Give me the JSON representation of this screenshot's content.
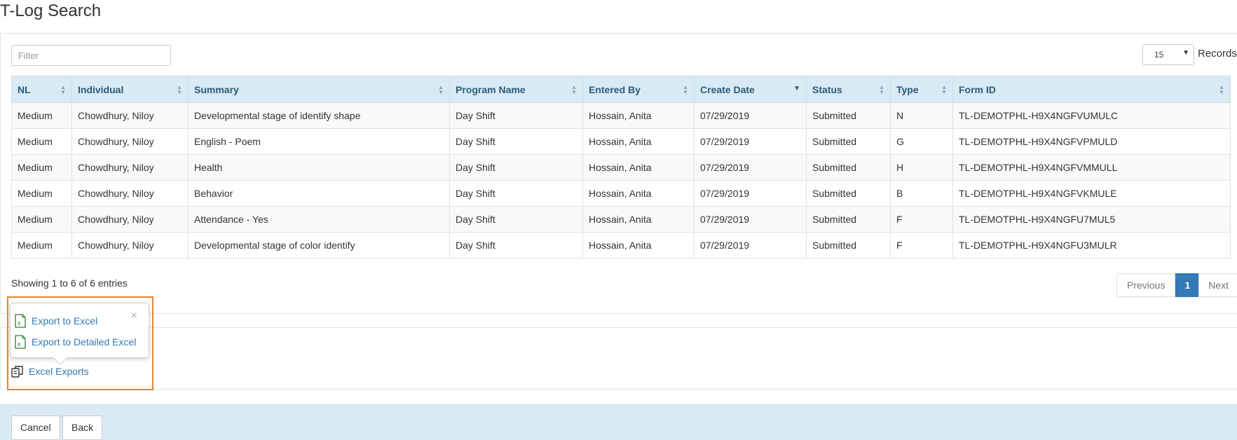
{
  "page": {
    "title": "T-Log Search"
  },
  "toolbar": {
    "filter_placeholder": "Filter",
    "page_size": "15",
    "records_label": "Records"
  },
  "table": {
    "columns": [
      "NL",
      "Individual",
      "Summary",
      "Program Name",
      "Entered By",
      "Create Date",
      "Status",
      "Type",
      "Form ID"
    ],
    "sorted_column": "Create Date",
    "sort_direction": "desc",
    "rows": [
      [
        "Medium",
        "Chowdhury, Niloy",
        "Developmental stage of identify shape",
        "Day Shift",
        "Hossain, Anita",
        "07/29/2019",
        "Submitted",
        "N",
        "TL-DEMOTPHL-H9X4NGFVUMULC"
      ],
      [
        "Medium",
        "Chowdhury, Niloy",
        "English - Poem",
        "Day Shift",
        "Hossain, Anita",
        "07/29/2019",
        "Submitted",
        "G",
        "TL-DEMOTPHL-H9X4NGFVPMULD"
      ],
      [
        "Medium",
        "Chowdhury, Niloy",
        "Health",
        "Day Shift",
        "Hossain, Anita",
        "07/29/2019",
        "Submitted",
        "H",
        "TL-DEMOTPHL-H9X4NGFVMMULL"
      ],
      [
        "Medium",
        "Chowdhury, Niloy",
        "Behavior",
        "Day Shift",
        "Hossain, Anita",
        "07/29/2019",
        "Submitted",
        "B",
        "TL-DEMOTPHL-H9X4NGFVKMULE"
      ],
      [
        "Medium",
        "Chowdhury, Niloy",
        "Attendance - Yes",
        "Day Shift",
        "Hossain, Anita",
        "07/29/2019",
        "Submitted",
        "F",
        "TL-DEMOTPHL-H9X4NGFU7MUL5"
      ],
      [
        "Medium",
        "Chowdhury, Niloy",
        "Developmental stage of color identify",
        "Day Shift",
        "Hossain, Anita",
        "07/29/2019",
        "Submitted",
        "F",
        "TL-DEMOTPHL-H9X4NGFU3MULR"
      ]
    ]
  },
  "pagination": {
    "info": "Showing 1 to 6 of 6 entries",
    "previous": "Previous",
    "current": "1",
    "next": "Next"
  },
  "exports": {
    "trigger_label": "Excel Exports",
    "popover_items": [
      "Export to Excel",
      "Export to Detailed Excel"
    ],
    "close_glyph": "×"
  },
  "footer": {
    "cancel_label": "Cancel",
    "back_label": "Back"
  },
  "colors": {
    "accent": "#337ab7",
    "header_bg": "#d9eaf4",
    "highlight": "#e8822b",
    "excel_green": "#2e7d32"
  }
}
